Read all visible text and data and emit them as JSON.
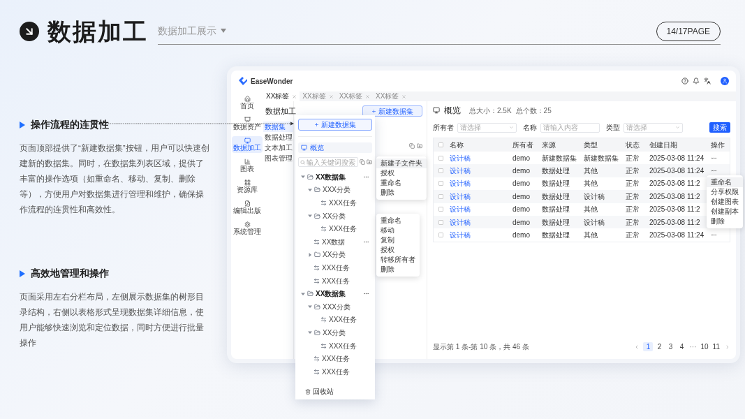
{
  "slide": {
    "title": "数据加工",
    "subtitle": "数据加工展示",
    "page": "14/17PAGE"
  },
  "sections": [
    {
      "title": "操作流程的连贯性",
      "body": "页面顶部提供了“新建数据集”按钮，用户可以快速创建新的数据集。同时，在数据集列表区域，提供了丰富的操作选项（如重命名、移动、复制、删除等），方便用户对数据集进行管理和维护，确保操作流程的连贯性和高效性。",
      "leader": true
    },
    {
      "title": "高效地管理和操作",
      "body": "页面采用左右分栏布局，左侧展示数据集的树形目录结构，右侧以表格形式呈现数据集详细信息，使用户能够快速浏览和定位数据，同时方便进行批量操作",
      "leader": false
    }
  ],
  "app": {
    "brand": "EaseWonder",
    "nav": [
      {
        "label": "首页",
        "selected": false
      },
      {
        "label": "数据资产",
        "selected": false
      },
      {
        "label": "数据加工",
        "selected": true
      },
      {
        "label": "图表",
        "selected": false
      },
      {
        "label": "资源库",
        "selected": false
      },
      {
        "label": "编辑出版",
        "selected": false
      },
      {
        "label": "系统管理",
        "selected": false
      }
    ],
    "tabs": [
      {
        "label": "XX标签",
        "selected": true
      },
      {
        "label": "XX标签",
        "selected": false
      },
      {
        "label": "XX标签",
        "selected": false
      },
      {
        "label": "XX标签",
        "selected": false
      }
    ],
    "subnav": {
      "title": "数据加工",
      "items": [
        {
          "label": "数据集",
          "selected": true
        },
        {
          "label": "数据处理",
          "selected": false
        },
        {
          "label": "文本加工",
          "selected": false
        },
        {
          "label": "图表管理",
          "selected": false
        }
      ]
    },
    "tree_column": {
      "new_button": "新建数据集"
    },
    "overview": {
      "title": "概览",
      "size_label": "总大小：",
      "size": "2.5K",
      "count_label": "总个数：",
      "count": "25"
    },
    "filters": [
      {
        "label": "所有者",
        "placeholder": "请选择",
        "kind": "select"
      },
      {
        "label": "名称",
        "placeholder": "请输入内容",
        "kind": "input"
      },
      {
        "label": "类型",
        "placeholder": "请选择",
        "kind": "select"
      }
    ],
    "search_button": "搜索",
    "table": {
      "columns": [
        "名称",
        "所有者",
        "来源",
        "类型",
        "状态",
        "创建日期",
        "操作"
      ],
      "header_checked": false,
      "rows": [
        {
          "checked": false,
          "cells": [
            "设计稿",
            "demo",
            "新建数据集",
            "新建数据集",
            "正常",
            "2025-03-08 11:24"
          ],
          "actions": true
        },
        {
          "checked": false,
          "cells": [
            "设计稿",
            "demo",
            "数据处理",
            "其他",
            "正常",
            "2025-03-08 11:24"
          ],
          "actions": true
        },
        {
          "checked": false,
          "cells": [
            "设计稿",
            "demo",
            "数据处理",
            "其他",
            "正常",
            "2025-03-08 11:2"
          ]
        },
        {
          "checked": false,
          "cells": [
            "设计稿",
            "demo",
            "数据处理",
            "设计稿",
            "正常",
            "2025-03-08 11:2"
          ]
        },
        {
          "checked": false,
          "cells": [
            "设计稿",
            "demo",
            "数据处理",
            "其他",
            "正常",
            "2025-03-08 11:2"
          ]
        },
        {
          "checked": false,
          "cells": [
            "设计稿",
            "demo",
            "数据处理",
            "设计稿",
            "正常",
            "2025-03-08 11:2"
          ]
        },
        {
          "checked": false,
          "cells": [
            "设计稿",
            "demo",
            "数据处理",
            "其他",
            "正常",
            "2025-03-08 11:24"
          ],
          "actions": true
        }
      ]
    },
    "footer": "显示第 1 条-第 10 条，共 46 条",
    "pagination": [
      {
        "label": "1",
        "kind": "page",
        "selected": true
      },
      {
        "label": "2",
        "kind": "page",
        "selected": false
      },
      {
        "label": "3",
        "kind": "page",
        "selected": false
      },
      {
        "label": "4",
        "kind": "page",
        "selected": false
      },
      {
        "label": "···",
        "kind": "ellipsis",
        "selected": false
      },
      {
        "label": "10",
        "kind": "page",
        "selected": false
      },
      {
        "label": "11",
        "kind": "page",
        "selected": false
      }
    ],
    "popup": {
      "new_button": "新建数据集",
      "overview": "概览",
      "search_placeholder": "输入关键词搜索",
      "recycle": "回收站",
      "tree": [
        {
          "label": "XX数据集",
          "kind": "folder",
          "expanded": true,
          "actions": true,
          "children": [
            {
              "label": "XXX分类",
              "kind": "folder",
              "expanded": true,
              "actions": false,
              "children": [
                {
                  "label": "XXX任务",
                  "kind": "task",
                  "actions": false
                }
              ]
            },
            {
              "label": "XX分类",
              "kind": "folder",
              "expanded": true,
              "actions": false,
              "children": [
                {
                  "label": "XXX任务",
                  "kind": "task",
                  "actions": false
                }
              ]
            },
            {
              "label": "XX数据",
              "kind": "task",
              "actions": true
            },
            {
              "label": "XX分类",
              "kind": "folder",
              "expanded": false,
              "actions": false
            },
            {
              "label": "XXX任务",
              "kind": "task",
              "actions": false
            },
            {
              "label": "XXX任务",
              "kind": "task",
              "actions": false
            }
          ]
        },
        {
          "label": "XX数据集",
          "kind": "folder",
          "expanded": true,
          "actions": true,
          "children": [
            {
              "label": "XXX分类",
              "kind": "folder",
              "expanded": true,
              "actions": false,
              "children": [
                {
                  "label": "XXX任务",
                  "kind": "task",
                  "actions": false
                }
              ]
            },
            {
              "label": "XX分类",
              "kind": "folder",
              "expanded": true,
              "actions": false,
              "children": [
                {
                  "label": "XXX任务",
                  "kind": "task",
                  "actions": false
                }
              ]
            },
            {
              "label": "XXX任务",
              "kind": "task",
              "actions": false
            },
            {
              "label": "XXX任务",
              "kind": "task",
              "actions": false
            }
          ]
        }
      ]
    },
    "menus": [
      {
        "items": [
          {
            "label": "新建子文件夹",
            "highlighted": true
          },
          {
            "label": "授权",
            "highlighted": false
          },
          {
            "label": "重命名",
            "highlighted": false
          },
          {
            "label": "删除",
            "highlighted": false
          }
        ]
      },
      {
        "items": [
          {
            "label": "重命名",
            "highlighted": false
          },
          {
            "label": "移动",
            "highlighted": false
          },
          {
            "label": "复制",
            "highlighted": false
          },
          {
            "label": "授权",
            "highlighted": false
          },
          {
            "label": "转移所有者",
            "highlighted": false
          },
          {
            "label": "删除",
            "highlighted": false
          }
        ]
      },
      {
        "items": [
          {
            "label": "重命名",
            "highlighted": true
          },
          {
            "label": "分享权限",
            "highlighted": false
          },
          {
            "label": "创建图表",
            "highlighted": false
          },
          {
            "label": "创建副本",
            "highlighted": false
          },
          {
            "label": "删除",
            "highlighted": false
          }
        ]
      }
    ]
  }
}
